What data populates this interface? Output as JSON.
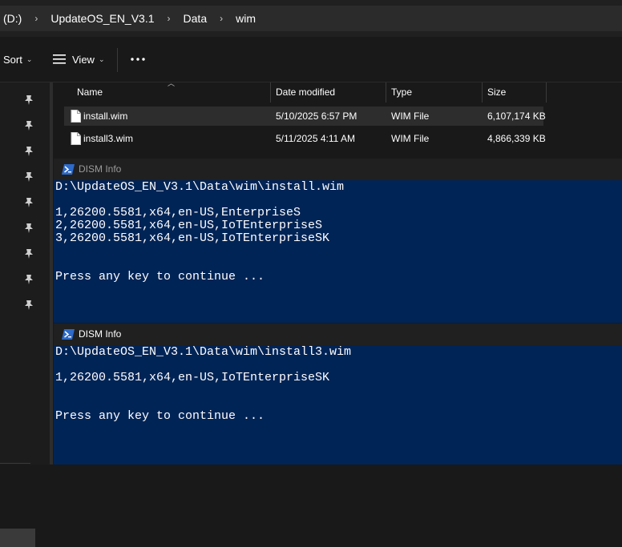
{
  "address": {
    "segments": [
      "(D:)",
      "UpdateOS_EN_V3.1",
      "Data",
      "wim"
    ]
  },
  "toolbar": {
    "sort_label": "Sort",
    "view_label": "View",
    "more_label": "⋯"
  },
  "file_list": {
    "columns": [
      "Name",
      "Date modified",
      "Type",
      "Size"
    ],
    "rows": [
      {
        "name": "install.wim",
        "date": "5/10/2025 6:57 PM",
        "type": "WIM File",
        "size": "6,107,174 KB",
        "selected": true
      },
      {
        "name": "install3.wim",
        "date": "5/11/2025 4:11 AM",
        "type": "WIM File",
        "size": "4,866,339 KB",
        "selected": false
      }
    ]
  },
  "console1": {
    "title": "DISM Info",
    "path": "D:\\UpdateOS_EN_V3.1\\Data\\wim\\install.wim",
    "lines": [
      "1,26200.5581,x64,en-US,EnterpriseS",
      "2,26200.5581,x64,en-US,IoTEnterpriseS",
      "3,26200.5581,x64,en-US,IoTEnterpriseSK"
    ],
    "prompt": "Press any key to continue ..."
  },
  "console2": {
    "title": "DISM Info",
    "path": "D:\\UpdateOS_EN_V3.1\\Data\\wim\\install3.wim",
    "lines": [
      "1,26200.5581,x64,en-US,IoTEnterpriseSK"
    ],
    "prompt": "Press any key to continue ..."
  },
  "colors": {
    "console_bg": "#012456",
    "explorer_bg": "#191919",
    "title_bar": "#202020"
  }
}
